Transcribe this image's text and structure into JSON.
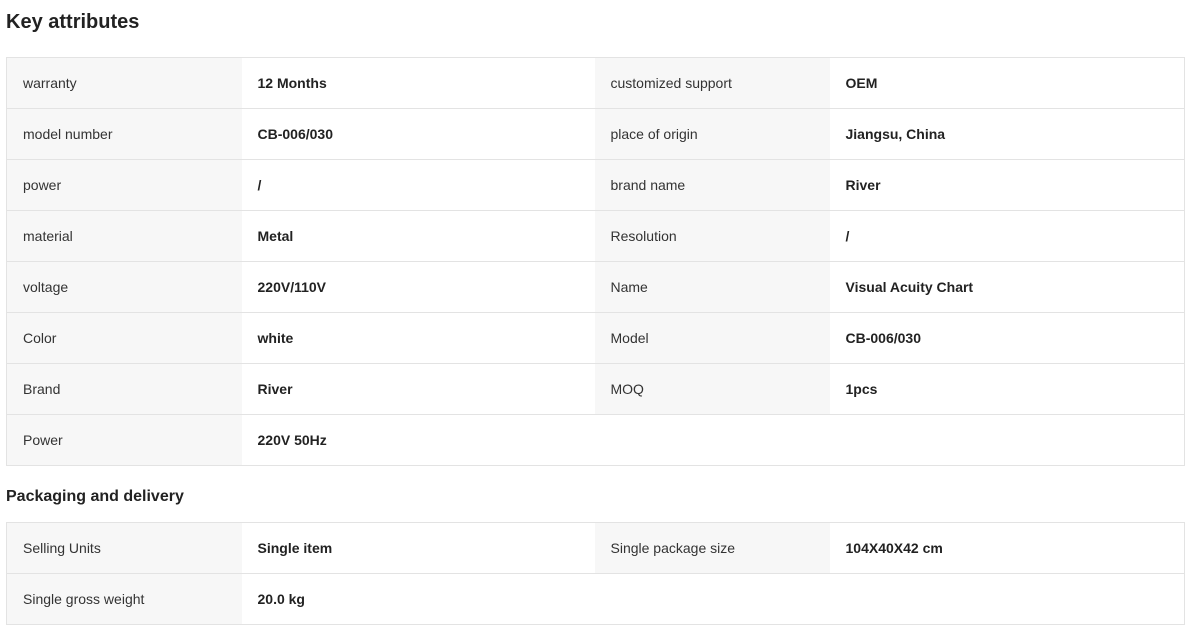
{
  "key_attributes": {
    "title": "Key attributes",
    "rows": [
      [
        {
          "k": "warranty",
          "v": "12 Months"
        },
        {
          "k": "customized support",
          "v": "OEM"
        }
      ],
      [
        {
          "k": "model number",
          "v": "CB-006/030"
        },
        {
          "k": "place of origin",
          "v": "Jiangsu, China"
        }
      ],
      [
        {
          "k": "power",
          "v": "/"
        },
        {
          "k": "brand name",
          "v": "River"
        }
      ],
      [
        {
          "k": "material",
          "v": "Metal"
        },
        {
          "k": "Resolution",
          "v": "/"
        }
      ],
      [
        {
          "k": "voltage",
          "v": "220V/110V"
        },
        {
          "k": "Name",
          "v": "Visual Acuity Chart"
        }
      ],
      [
        {
          "k": "Color",
          "v": "white"
        },
        {
          "k": "Model",
          "v": "CB-006/030"
        }
      ],
      [
        {
          "k": "Brand",
          "v": "River"
        },
        {
          "k": "MOQ",
          "v": "1pcs"
        }
      ],
      [
        {
          "k": "Power",
          "v": "220V 50Hz"
        }
      ]
    ]
  },
  "packaging": {
    "title": "Packaging and delivery",
    "rows": [
      [
        {
          "k": "Selling Units",
          "v": "Single item"
        },
        {
          "k": "Single package size",
          "v": "104X40X42 cm"
        }
      ],
      [
        {
          "k": "Single gross weight",
          "v": "20.0 kg"
        }
      ]
    ]
  }
}
